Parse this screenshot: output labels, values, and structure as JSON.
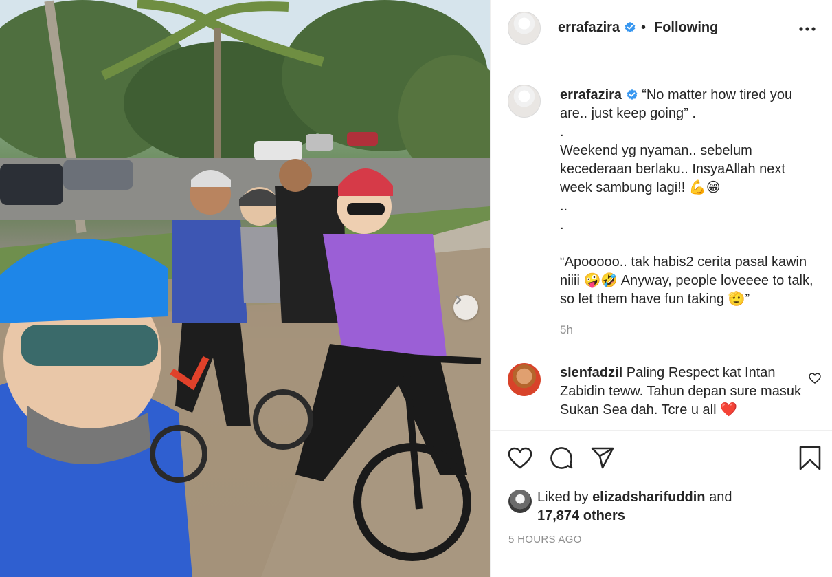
{
  "post": {
    "username": "errafazira",
    "follow_status": "Following",
    "dot": "•"
  },
  "caption": {
    "username": "errafazira",
    "lines": [
      "“No matter how tired you are.. just keep going” .",
      ".",
      "Weekend yg nyaman.. sebelum kecederaan berlaku.. InsyaAllah next week sambung lagi!! 💪😁",
      "..",
      ".",
      "",
      "“Apooooo.. tak habis2 cerita pasal kawin niiii 🤪🤣 Anyway, people loveeee to talk, so let them have fun taking 🫡”"
    ],
    "time_ago": "5h"
  },
  "comment": {
    "username": "slenfadzil",
    "text": "Paling Respect kat Intan Zabidin teww. Tahun depan sure masuk Sukan Sea dah. Tcre u all ❤️"
  },
  "likes": {
    "prefix": "Liked by",
    "user": "elizadsharifuddin",
    "middle": "and",
    "count": "17,874 others"
  },
  "timestamp": "5 HOURS AGO",
  "colors": {
    "verified": "#3897f0",
    "heart": "#ed4956",
    "text": "#262626",
    "muted": "#8e8e8e"
  },
  "icons": [
    "more-icon",
    "verified-icon",
    "heart-icon",
    "comment-icon",
    "share-icon",
    "save-icon",
    "next-arrow-icon"
  ]
}
